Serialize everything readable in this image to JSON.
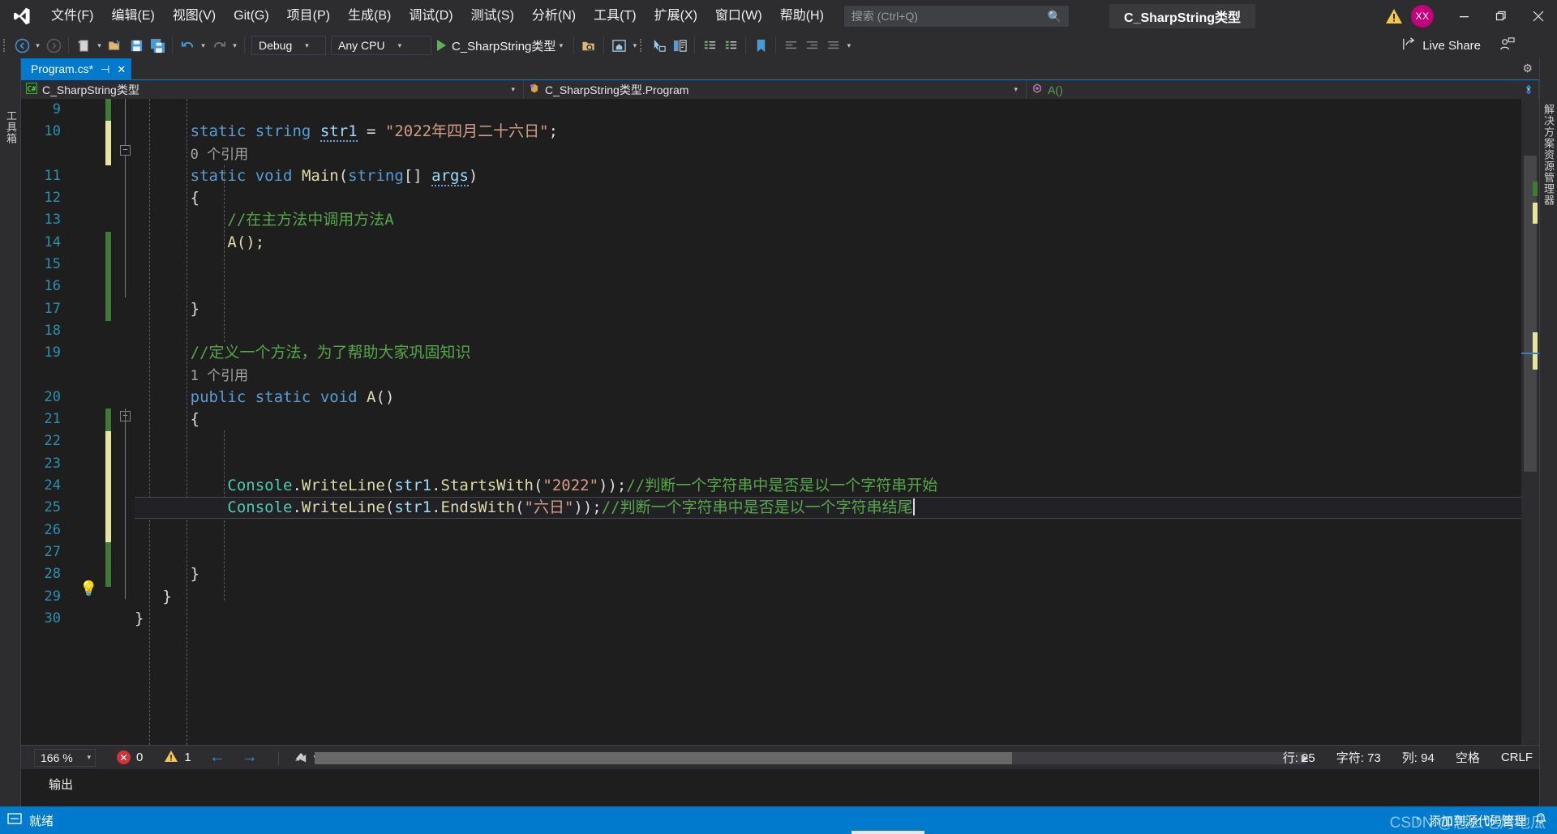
{
  "window": {
    "title": "C_SharpString类型",
    "avatar_initials": "XX",
    "minimize_icon": "minimize-icon",
    "restore_icon": "restore-icon",
    "close_icon": "close-icon",
    "warning_icon": "warning-triangle-icon",
    "accent_color": "#007acc"
  },
  "menu": {
    "items": [
      "文件(F)",
      "编辑(E)",
      "视图(V)",
      "Git(G)",
      "项目(P)",
      "生成(B)",
      "调试(D)",
      "测试(S)",
      "分析(N)",
      "工具(T)",
      "扩展(X)",
      "窗口(W)",
      "帮助(H)"
    ]
  },
  "search": {
    "placeholder": "搜索 (Ctrl+Q)",
    "value": "",
    "icon": "search-icon"
  },
  "toolbar": {
    "nav_back_icon": "navigate-back-icon",
    "nav_forward_icon": "navigate-forward-icon",
    "new_project_icon": "new-project-icon",
    "open_icon": "open-folder-icon",
    "save_icon": "save-icon",
    "save_all_icon": "save-all-icon",
    "undo_icon": "undo-icon",
    "redo_icon": "redo-icon",
    "configuration": "Debug",
    "platform": "Any CPU",
    "start_label": "C_SharpString类型",
    "start_icon": "run-play-icon",
    "search_folder_icon": "search-folder-icon",
    "home_icon": "home-window-icon",
    "select_icon": "pointer-select-icon",
    "compare_icon": "compare-window-icon",
    "list_icon": "list-view-icon",
    "bookmark_icon": "bookmark-icon",
    "indent_icons": [
      "indent-left-icon",
      "indent-right-icon",
      "indent-more-icon"
    ],
    "live_share_label": "Live Share",
    "live_share_icon": "live-share-icon",
    "person_icon": "person-chat-icon"
  },
  "rails": {
    "left_label": "工具箱",
    "right_label": "解决方案资源管理器"
  },
  "tabs": [
    {
      "label": "Program.cs*",
      "pin_icon": "pin-icon",
      "close_icon": "close-icon",
      "active": true
    }
  ],
  "tab_settings_icon": "gear-icon",
  "navbar": {
    "project": "C_SharpString类型",
    "project_icon": "csharp-file-icon",
    "type": "C_SharpString类型.Program",
    "type_icon": "class-icon",
    "member": "A()",
    "member_icon": "method-icon",
    "expand_icon": "expand-arrows-icon"
  },
  "editor": {
    "first_visible_line": 9,
    "lines": [
      {
        "n": 9,
        "text": "",
        "change": "saved"
      },
      {
        "n": 10,
        "text": "        static string str1 = \"2022年四月二十六日\";",
        "change": "unsaved"
      },
      {
        "n": null,
        "text": "        0 个引用",
        "kind": "codelens"
      },
      {
        "n": 11,
        "text": "        static void Main(string[] args)",
        "fold": true
      },
      {
        "n": 12,
        "text": "        {"
      },
      {
        "n": 13,
        "text": "            //在主方法中调用方法A"
      },
      {
        "n": 14,
        "text": "            A();",
        "change": "saved"
      },
      {
        "n": 15,
        "text": "",
        "change": "saved"
      },
      {
        "n": 16,
        "text": "",
        "change": "saved"
      },
      {
        "n": 17,
        "text": "        }"
      },
      {
        "n": 18,
        "text": ""
      },
      {
        "n": 19,
        "text": "        //定义一个方法，为了帮助大家巩固知识"
      },
      {
        "n": null,
        "text": "        1 个引用",
        "kind": "codelens"
      },
      {
        "n": 20,
        "text": "        public static void A()",
        "fold": true
      },
      {
        "n": 21,
        "text": "        {",
        "change": "saved"
      },
      {
        "n": 22,
        "text": "",
        "change": "unsaved"
      },
      {
        "n": 23,
        "text": "",
        "change": "unsaved"
      },
      {
        "n": 24,
        "text": "            Console.WriteLine(str1.StartsWith(\"2022\"));//判断一个字符串中是否是以一个字符串开始",
        "change": "unsaved"
      },
      {
        "n": 25,
        "text": "            Console.WriteLine(str1.EndsWith(\"六日\"));//判断一个字符串中是否是以一个字符串结尾",
        "change": "unsaved",
        "current": true
      },
      {
        "n": 26,
        "text": "",
        "change": "unsaved"
      },
      {
        "n": 27,
        "text": "",
        "change": "saved"
      },
      {
        "n": 28,
        "text": "        }"
      },
      {
        "n": 29,
        "text": "    }"
      },
      {
        "n": 30,
        "text": "}"
      }
    ],
    "code_lines_display": {
      "l10": {
        "kw1": "static",
        "kw2": "string",
        "var": "str1",
        "eq": " = ",
        "str": "\"2022年四月二十六日\"",
        "semi": ";"
      },
      "l11": {
        "kw1": "static",
        "kw2": "void",
        "method": "Main",
        "params": "string[] args"
      },
      "l13": "//在主方法中调用方法A",
      "l14": "A();",
      "l19": "//定义一个方法，为了帮助大家巩固知识",
      "l20": {
        "kw1": "public",
        "kw2": "static",
        "kw3": "void",
        "method": "A"
      },
      "l24": {
        "obj": "Console",
        "method": "WriteLine",
        "arg_obj": "str1",
        "arg_method": "StartsWith",
        "arg_str": "\"2022\"",
        "comment": "//判断一个字符串中是否是以一个字符串开始"
      },
      "l25": {
        "obj": "Console",
        "method": "WriteLine",
        "arg_obj": "str1",
        "arg_method": "EndsWith",
        "arg_str": "\"六日\"",
        "comment": "//判断一个字符串中是否是以一个字符串结尾"
      }
    },
    "codelens_0": "0 个引用",
    "codelens_1": "1 个引用",
    "lightbulb_icon": "lightbulb-icon",
    "colors": {
      "background": "#1e1e1e",
      "keyword": "#569cd6",
      "type": "#4ec9b0",
      "method": "#dcdcaa",
      "string": "#d69d85",
      "comment": "#57a64a",
      "linenumber": "#2b91af",
      "unsaved_change": "#e6e6a0",
      "saved_change": "#3f7a36"
    }
  },
  "editor_status": {
    "zoom": "166 %",
    "zoom_dropdown_icon": "chevron-down-icon",
    "error_count": "0",
    "error_icon": "error-circle-icon",
    "warning_count": "1",
    "warning_icon": "warning-triangle-icon",
    "prev_icon": "arrow-left-icon",
    "next_icon": "arrow-right-icon",
    "brush_icon": "brush-icon",
    "line_label": "行:",
    "line_value": "25",
    "char_label": "字符:",
    "char_value": "73",
    "col_label": "列:",
    "col_value": "94",
    "whitespace": "空格",
    "eol": "CRLF"
  },
  "output": {
    "label": "输出"
  },
  "statusbar": {
    "ready_icon": "ready-icon",
    "ready": "就绪",
    "source_control_icon": "up-arrow-icon",
    "source_control": "添加到源代码管理",
    "notify_icon": "notification-icon",
    "watermark": "CSDN @怎么吃烤地瓜"
  }
}
